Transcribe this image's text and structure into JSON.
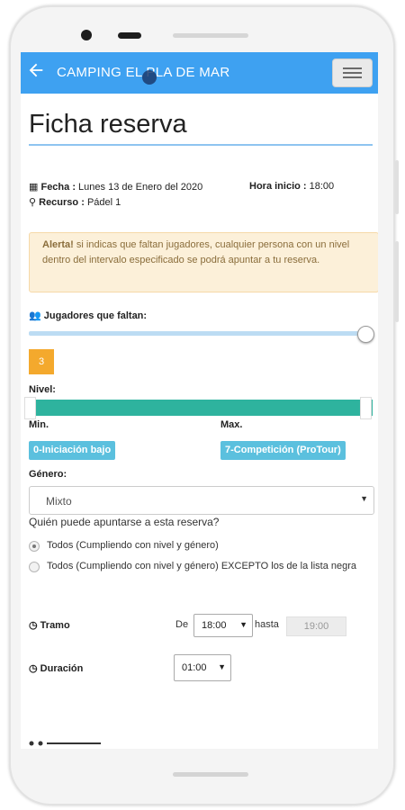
{
  "app_bar": {
    "title": "CAMPING EL PLA DE MAR",
    "back_icon": "arrow-left-icon",
    "menu_icon": "hamburger-icon"
  },
  "page": {
    "title": "Ficha reserva"
  },
  "booking": {
    "date_label": "Fecha :",
    "date_value": "Lunes 13 de Enero del 2020",
    "start_label": "Hora inicio :",
    "start_value": "18:00",
    "resource_label": "Recurso :",
    "resource_value": "Pádel 1"
  },
  "alert": {
    "strong": "Alerta!",
    "text": " si indicas que faltan jugadores, cualquier persona con un nivel dentro del intervalo especificado se podrá apuntar a tu reserva."
  },
  "players": {
    "label": "Jugadores que faltan:",
    "value": "3",
    "slider_fraction": 1.0
  },
  "level": {
    "label": "Nivel:",
    "min_label": "Min.",
    "max_label": "Max.",
    "min_value": "0-Iniciación bajo",
    "max_value": "7-Competición (ProTour)"
  },
  "gender": {
    "label": "Género:",
    "value": "Mixto"
  },
  "who": {
    "question": "Quién puede apuntarse a esta reserva?",
    "options": [
      {
        "label": "Todos (Cumpliendo con nivel y género)",
        "checked": true
      },
      {
        "label": "Todos (Cumpliendo con nivel y género) EXCEPTO los de la lista negra",
        "checked": false
      }
    ]
  },
  "slot": {
    "label": "Tramo",
    "from_label": "De",
    "from_value": "18:00",
    "to_label": "hasta",
    "to_value": "19:00"
  },
  "duration": {
    "label": "Duración",
    "value": "01:00"
  },
  "colors": {
    "app_bar": "#3ea1f1",
    "alert_bg": "#fcf0d9",
    "count_badge": "#f4a92d",
    "range": "#2eb39e",
    "level_badge": "#5bc0de"
  }
}
